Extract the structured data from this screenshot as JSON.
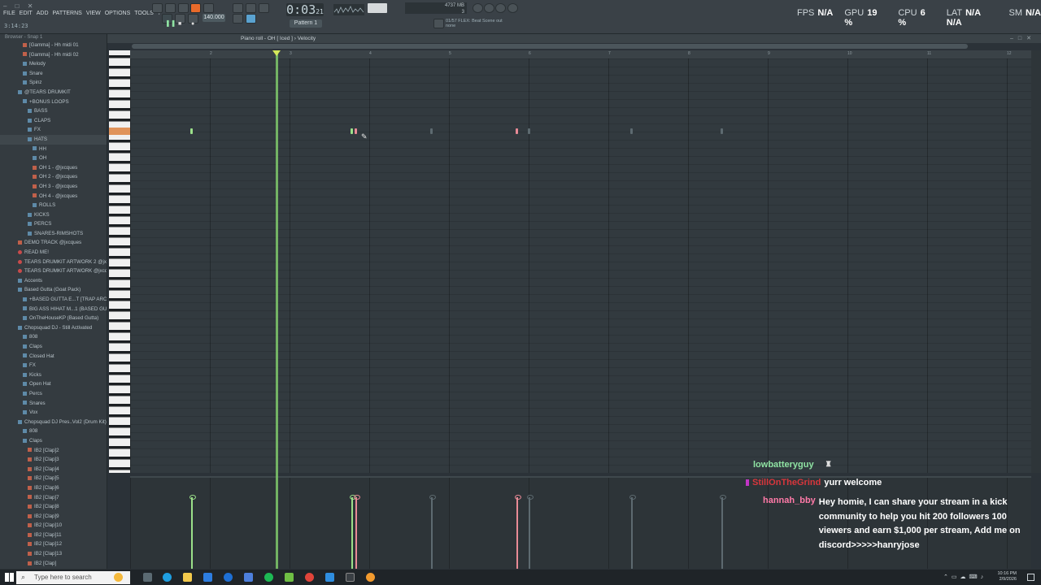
{
  "app": {
    "window_controls": "– □ ✕",
    "menu": [
      "FILE",
      "EDIT",
      "ADD",
      "PATTERNS",
      "VIEW",
      "OPTIONS",
      "TOOLS",
      "?"
    ],
    "song_position": "3:14:23",
    "time_display": {
      "main": "0:03",
      "sub": "21"
    },
    "tempo": "140.000",
    "pattern": "Pattern 1",
    "memory": "4737 MB",
    "mem_sub": "3",
    "hint_line1": "01/57 FLEX: Beat Scene out",
    "hint_line2": "none"
  },
  "stats": [
    {
      "label": "FPS",
      "value": "N/A"
    },
    {
      "label": "GPU",
      "value": "19 %"
    },
    {
      "label": "CPU",
      "value": "6 %"
    },
    {
      "label": "LAT",
      "value": "N/A N/A"
    },
    {
      "label": "SM",
      "value": "N/A"
    }
  ],
  "browser": {
    "header": "Browser - Snap 1",
    "items": [
      {
        "label": "[Gamma] - Hh midi 01",
        "type": "file"
      },
      {
        "label": "[Gamma] - Hh midi 02",
        "type": "file"
      },
      {
        "label": "Melody",
        "type": "fold"
      },
      {
        "label": "Snare",
        "type": "fold"
      },
      {
        "label": "Spinz",
        "type": "fold"
      },
      {
        "label": "@TEARS DRUMKIT",
        "type": "fold"
      },
      {
        "label": "+BONUS LOOPS",
        "type": "fold"
      },
      {
        "label": "BASS",
        "type": "fold"
      },
      {
        "label": "CLAPS",
        "type": "fold"
      },
      {
        "label": "FX",
        "type": "fold"
      },
      {
        "label": "HATS",
        "type": "fold",
        "selected": true
      },
      {
        "label": "HH",
        "type": "fold"
      },
      {
        "label": "OH",
        "type": "fold"
      },
      {
        "label": "OH 1 - @jxcques",
        "type": "file"
      },
      {
        "label": "OH 2 - @jxcques",
        "type": "file"
      },
      {
        "label": "OH 3 - @jxcques",
        "type": "file"
      },
      {
        "label": "OH 4 - @jxcques",
        "type": "file"
      },
      {
        "label": "ROLLS",
        "type": "fold"
      },
      {
        "label": "KICKS",
        "type": "fold"
      },
      {
        "label": "PERCS",
        "type": "fold"
      },
      {
        "label": "SNARES-RIMSHOTS",
        "type": "fold"
      },
      {
        "label": "DEMO TRACK @jxcques",
        "type": "file"
      },
      {
        "label": "READ ME!",
        "type": "heart"
      },
      {
        "label": "TEARS DRUMKIT ARTWORK 2 @jxcques",
        "type": "heart"
      },
      {
        "label": "TEARS DRUMKIT ARTWORK @jxcques",
        "type": "heart"
      },
      {
        "label": "Accents",
        "type": "fold"
      },
      {
        "label": "Based Gutta (Goat Pack)",
        "type": "fold"
      },
      {
        "label": "+BASED GUTTA E...T [TRAP ARCHIVE]",
        "type": "fold"
      },
      {
        "label": "BIG ASS HIHAT M...1 (BASED GUTTA)",
        "type": "fold"
      },
      {
        "label": "OnTheHouseKP (Based Gutta)",
        "type": "fold"
      },
      {
        "label": "Chopsquad DJ - Still Activated",
        "type": "fold"
      },
      {
        "label": "808",
        "type": "fold"
      },
      {
        "label": "Claps",
        "type": "fold"
      },
      {
        "label": "Closed Hat",
        "type": "fold"
      },
      {
        "label": "FX",
        "type": "fold"
      },
      {
        "label": "Kicks",
        "type": "fold"
      },
      {
        "label": "Open Hat",
        "type": "fold"
      },
      {
        "label": "Percs",
        "type": "fold"
      },
      {
        "label": "Snares",
        "type": "fold"
      },
      {
        "label": "Vox",
        "type": "fold"
      },
      {
        "label": "Chopsquad DJ Pres..Vol2 (Drum Kit)",
        "type": "fold"
      },
      {
        "label": "808",
        "type": "fold"
      },
      {
        "label": "Claps",
        "type": "fold"
      },
      {
        "label": "IB2 [Clap]2",
        "type": "file"
      },
      {
        "label": "IB2 [Clap]3",
        "type": "file"
      },
      {
        "label": "IB2 [Clap]4",
        "type": "file"
      },
      {
        "label": "IB2 [Clap]5",
        "type": "file"
      },
      {
        "label": "IB2 [Clap]6",
        "type": "file"
      },
      {
        "label": "IB2 [Clap]7",
        "type": "file"
      },
      {
        "label": "IB2 [Clap]8",
        "type": "file"
      },
      {
        "label": "IB2 [Clap]9",
        "type": "file"
      },
      {
        "label": "IB2 [Clap]10",
        "type": "file"
      },
      {
        "label": "IB2 [Clap]11",
        "type": "file"
      },
      {
        "label": "IB2 [Clap]12",
        "type": "file"
      },
      {
        "label": "IB2 [Clap]13",
        "type": "file"
      },
      {
        "label": "IB2 [Clap]",
        "type": "file"
      },
      {
        "label": "Crashes & Cymbals",
        "type": "fold"
      },
      {
        "label": "IB2 [CC]1",
        "type": "file"
      }
    ]
  },
  "piano_roll": {
    "title": "Piano roll - OH [ Iced ]",
    "target": "Velocity",
    "ruler_marks": [
      "2",
      "3",
      "4",
      "5",
      "6",
      "7",
      "8",
      "9",
      "10",
      "11",
      "12"
    ],
    "notes": [
      {
        "pos": 74,
        "color": "#9be08a",
        "vel": 0.8
      },
      {
        "pos": 271,
        "color": "#9be08a",
        "vel": 0.8
      },
      {
        "pos": 276,
        "color": "#e88a96",
        "vel": 0.8
      },
      {
        "pos": 474,
        "color": "#e88a96",
        "vel": 0.8
      },
      {
        "pos": 369,
        "color": "#5d6a70",
        "vel": 0.8
      },
      {
        "pos": 615,
        "color": "#5d6a70",
        "vel": 0.8
      },
      {
        "pos": 726,
        "color": "#5d6a70",
        "vel": 0.8
      },
      {
        "pos": 489,
        "color": "#5d6a70",
        "vel": 0.8
      }
    ]
  },
  "chat": [
    {
      "user": "lowbatteryguy",
      "user_color": "#8fe3a3",
      "text": ""
    },
    {
      "user": "StillOnTheGrind",
      "user_color": "#d8363c",
      "text": "yurr welcome"
    },
    {
      "user": "hannah_bby",
      "user_color": "#ff7aa8",
      "text": "Hey homie, I can share your stream in a kick community to help you hit 200 followers 100 viewers and earn $1,000 per stream, Add me on discord>>>>>hanryjose"
    }
  ],
  "taskbar": {
    "search_placeholder": "Type here to search",
    "time": "10:16 PM",
    "date": "2/9/2026"
  }
}
